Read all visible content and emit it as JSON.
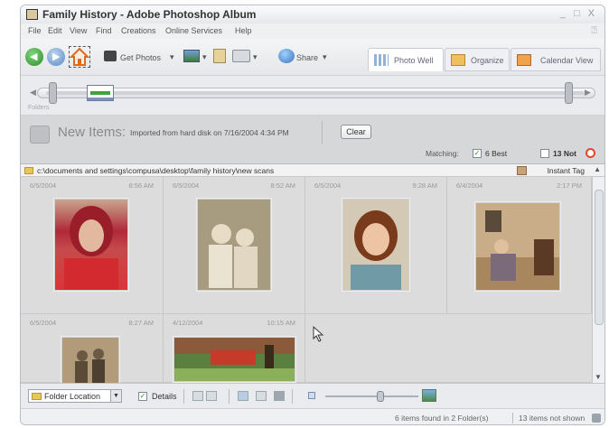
{
  "window": {
    "title": "Family History - Adobe Photoshop Album",
    "controls": "_ □ X"
  },
  "menu": [
    "File",
    "Edit",
    "View",
    "Find",
    "Creations",
    "Online Services",
    "Help"
  ],
  "toolbar": {
    "get_photos": "Get Photos",
    "share": "Share",
    "tabs": [
      "Photo Well",
      "Organize",
      "Calendar View"
    ]
  },
  "timeline": {
    "label": "Folders"
  },
  "new_items": {
    "title": "New Items:",
    "subtitle": "Imported from hard disk on 7/16/2004 4:34 PM",
    "clear": "Clear",
    "matching_label": "Matching:",
    "best_count": "6 Best",
    "not_count": "13 Not",
    "best_checked": true,
    "not_checked": false
  },
  "path": {
    "value": "c:\\documents and settings\\compusa\\desktop\\family history\\new scans",
    "instant_tag": "Instant Tag"
  },
  "photos": [
    {
      "date": "6/5/2004",
      "time": "8:56 AM",
      "desc": "red-haired woman portrait"
    },
    {
      "date": "6/5/2004",
      "time": "8:52 AM",
      "desc": "two girls sepia photo"
    },
    {
      "date": "6/5/2004",
      "time": "9:28 AM",
      "desc": "smiling child portrait"
    },
    {
      "date": "6/4/2004",
      "time": "2:17 PM",
      "desc": "family in living room"
    },
    {
      "date": "6/5/2004",
      "time": "8:27 AM",
      "desc": "old sepia couple"
    },
    {
      "date": "4/12/2004",
      "time": "10:15 AM",
      "desc": "outdoor scene with car"
    }
  ],
  "bottom": {
    "sort": "Folder Location",
    "details": "Details",
    "details_checked": true
  },
  "status": {
    "found": "6 items found in 2 Folder(s)",
    "not_shown": "13 items not shown"
  },
  "colors": {
    "accent": "#3ea33a",
    "not_icon": "#e0472b"
  }
}
